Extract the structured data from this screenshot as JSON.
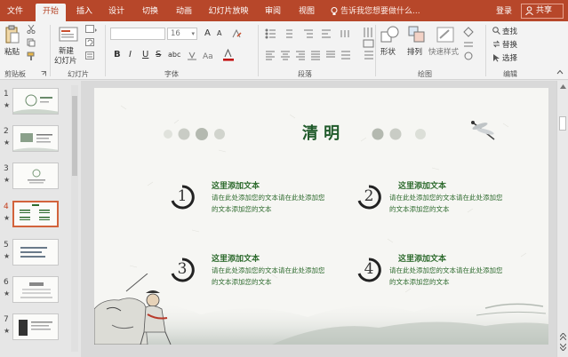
{
  "tabs": [
    {
      "id": "file",
      "label": "文件"
    },
    {
      "id": "home",
      "label": "开始"
    },
    {
      "id": "insert",
      "label": "插入"
    },
    {
      "id": "design",
      "label": "设计"
    },
    {
      "id": "transitions",
      "label": "切换"
    },
    {
      "id": "animations",
      "label": "动画"
    },
    {
      "id": "slideshow",
      "label": "幻灯片放映"
    },
    {
      "id": "review",
      "label": "审阅"
    },
    {
      "id": "view",
      "label": "视图"
    }
  ],
  "tell_me": "告诉我您想要做什么...",
  "login": "登录",
  "share": "共享",
  "ribbon": {
    "paste": "粘贴",
    "clipboard_group": "剪贴板",
    "new_slide": "新建",
    "new_slide_2": "幻灯片",
    "slides_group": "幻灯片",
    "font_size": "16",
    "font_group": "字体",
    "paragraph_group": "段落",
    "shapes": "形状",
    "arrange": "排列",
    "quick_styles": "快速样式",
    "drawing_group": "绘图",
    "find": "查找",
    "replace": "替换",
    "select": "选择",
    "editing_group": "编辑",
    "bold": "B",
    "italic": "I",
    "underline": "U",
    "strike": "S",
    "shadow": "abc",
    "grow": "A",
    "shrink": "A"
  },
  "thumbnails": [
    {
      "num": "1",
      "star": "★"
    },
    {
      "num": "2",
      "star": "★"
    },
    {
      "num": "3",
      "star": "★"
    },
    {
      "num": "4",
      "star": "★"
    },
    {
      "num": "5",
      "star": "★"
    },
    {
      "num": "6",
      "star": "★"
    },
    {
      "num": "7",
      "star": "★"
    }
  ],
  "slide": {
    "title": "清 明",
    "items": [
      {
        "num": "1",
        "title": "这里添加文本",
        "text": "请在此处添加您的文本请在此处添加您的文本添加您的文本"
      },
      {
        "num": "2",
        "title": "这里添加文本",
        "text": "请在此处添加您的文本请在此处添加您的文本添加您的文本"
      },
      {
        "num": "3",
        "title": "这里添加文本",
        "text": "请在此处添加您的文本请在此处添加您的文本添加您的文本"
      },
      {
        "num": "4",
        "title": "这里添加文本",
        "text": "请在此处添加您的文本请在此处添加您的文本添加您的文本"
      }
    ]
  },
  "colors": {
    "accent": "#b7472a",
    "text_green": "#2e6b2e"
  }
}
